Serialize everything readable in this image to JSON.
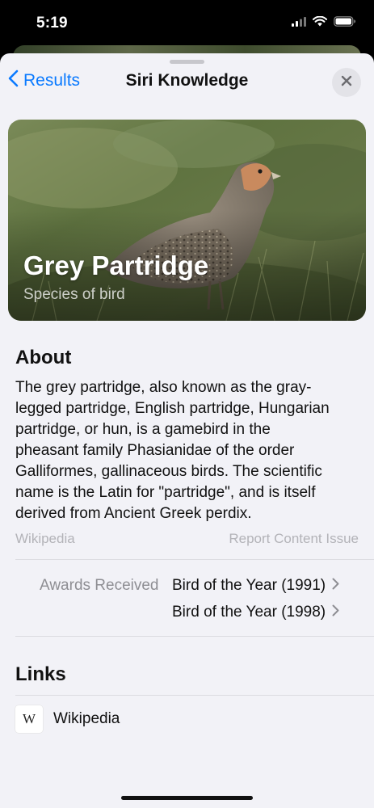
{
  "status_bar": {
    "time": "5:19"
  },
  "nav": {
    "back_label": "Results",
    "title": "Siri Knowledge"
  },
  "hero": {
    "title": "Grey Partridge",
    "subtitle": "Species of bird"
  },
  "about": {
    "heading": "About",
    "lines": [
      "The grey partridge, also known as the gray-",
      "legged partridge, English partridge, Hungarian",
      "partridge, or hun, is a gamebird in the",
      "pheasant family Phasianidae of the order",
      "Galliformes, gallinaceous birds. The scientific",
      "name is the Latin for \"partridge\", and is itself",
      "derived from Ancient Greek perdix."
    ],
    "source": "Wikipedia",
    "report_label": "Report Content Issue"
  },
  "awards": {
    "label": "Awards Received",
    "items": [
      "Bird of the Year (1991)",
      "Bird of the Year (1998)"
    ]
  },
  "links": {
    "heading": "Links",
    "items": [
      {
        "icon_text": "W",
        "label": "Wikipedia"
      }
    ]
  },
  "colors": {
    "accent": "#0a7aff",
    "sheet_bg": "#f2f2f7",
    "secondary_text": "#8e8e93"
  }
}
